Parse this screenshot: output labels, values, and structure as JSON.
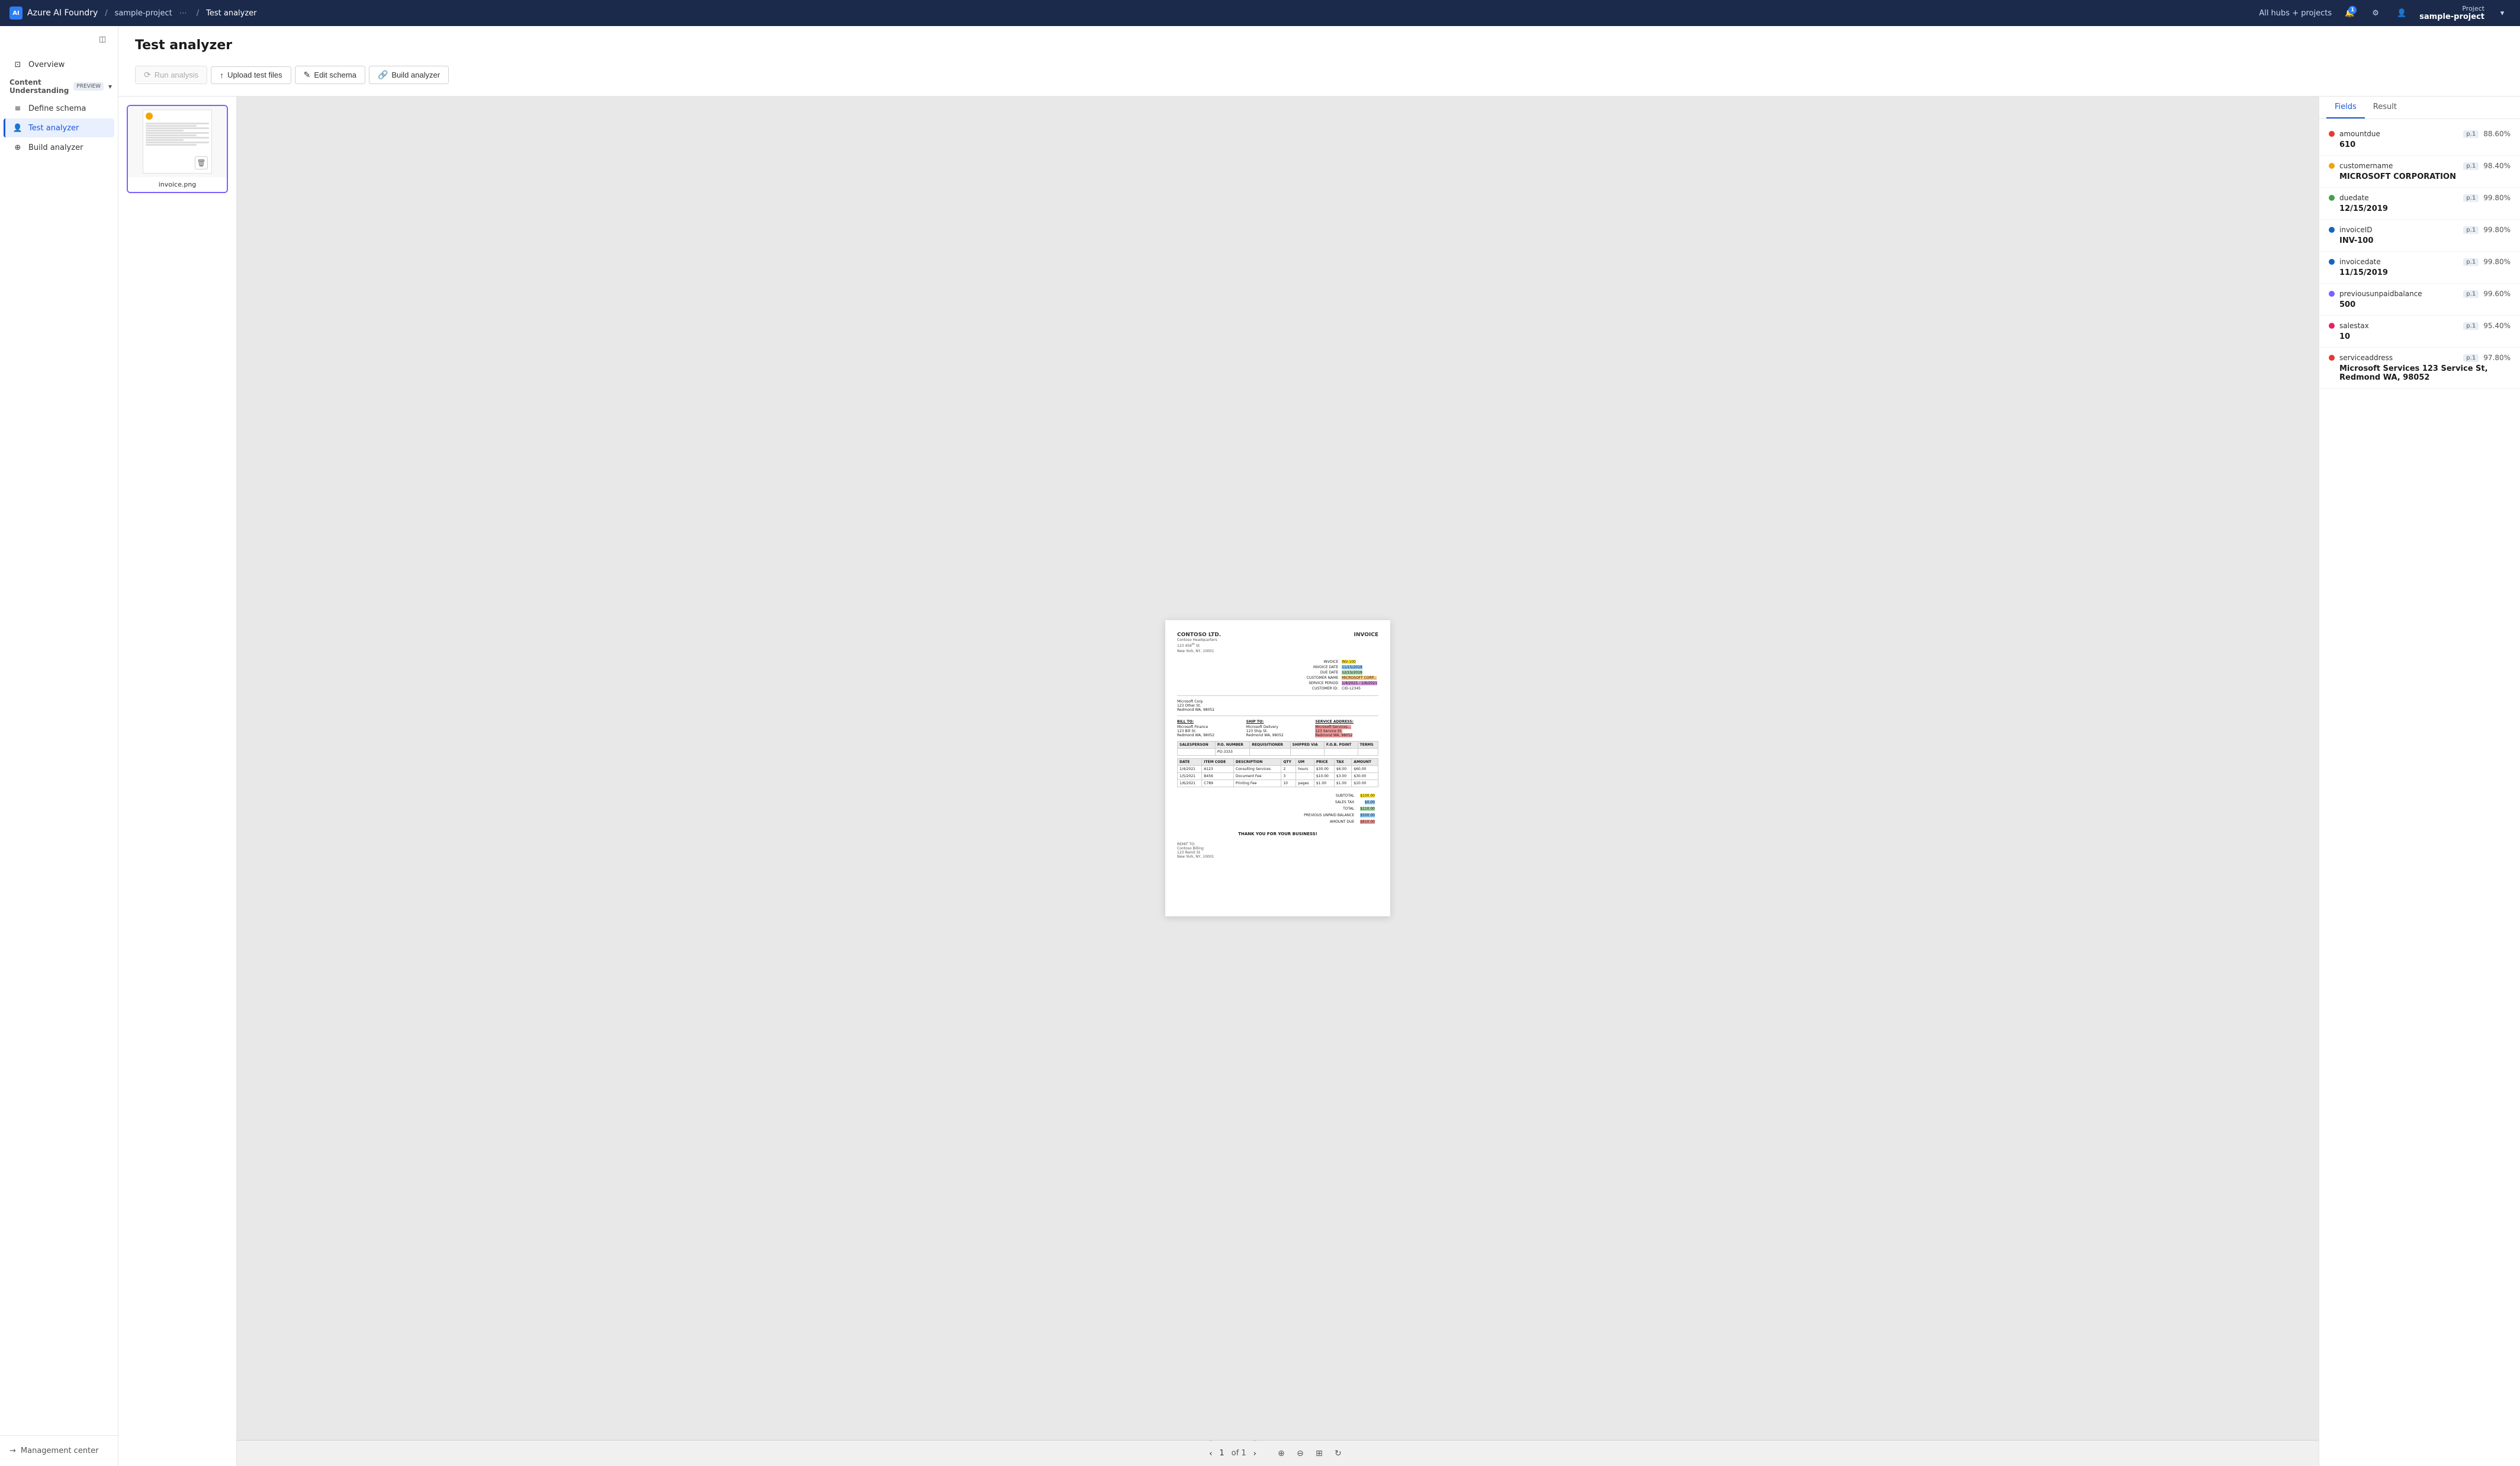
{
  "topNav": {
    "brand": "Azure AI Foundry",
    "project": "sample-project",
    "separator1": "/",
    "currentPage": "Test analyzer",
    "hubsLink": "All hubs + projects",
    "notificationCount": "1",
    "projectLabel": "Project",
    "projectName": "sample-project"
  },
  "sidebar": {
    "toggleIcon": "◫",
    "items": [
      {
        "id": "overview",
        "label": "Overview",
        "icon": "⊡"
      },
      {
        "id": "content-understanding",
        "label": "Content Understanding",
        "preview": "PREVIEW",
        "isSection": true
      },
      {
        "id": "define-schema",
        "label": "Define schema",
        "icon": "≡"
      },
      {
        "id": "test-analyzer",
        "label": "Test analyzer",
        "icon": "👤",
        "active": true
      },
      {
        "id": "build-analyzer",
        "label": "Build analyzer",
        "icon": "⊕"
      }
    ],
    "bottomItem": {
      "label": "Management center",
      "icon": "→"
    }
  },
  "page": {
    "title": "Test analyzer"
  },
  "toolbar": {
    "runAnalysis": "Run analysis",
    "uploadTestFiles": "Upload test files",
    "editSchema": "Edit schema",
    "buildAnalyzer": "Build analyzer"
  },
  "filePanel": {
    "file": {
      "name": "invoice.png",
      "hasCircle": true
    }
  },
  "docViewer": {
    "pageNumber": "1",
    "pageInfo": "of 1"
  },
  "fieldsPanel": {
    "tabs": [
      "Fields",
      "Result"
    ],
    "activeTab": "Fields",
    "fields": [
      {
        "id": "amountdue",
        "name": "amountdue",
        "dot": "#e53935",
        "page": "p.1",
        "confidence": "88.60%",
        "value": "610"
      },
      {
        "id": "customername",
        "name": "customername",
        "dot": "#f0a500",
        "page": "p.1",
        "confidence": "98.40%",
        "value": "MICROSOFT CORPORATION"
      },
      {
        "id": "duedate",
        "name": "duedate",
        "dot": "#43a047",
        "page": "p.1",
        "confidence": "99.80%",
        "value": "12/15/2019"
      },
      {
        "id": "invoiceID",
        "name": "invoiceID",
        "dot": "#1565c0",
        "page": "p.1",
        "confidence": "99.80%",
        "value": "INV-100"
      },
      {
        "id": "invoicedate",
        "name": "invoicedate",
        "dot": "#1565c0",
        "page": "p.1",
        "confidence": "99.80%",
        "value": "11/15/2019"
      },
      {
        "id": "previousunpaidbalance",
        "name": "previousunpaidbalance",
        "dot": "#7b61ff",
        "page": "p.1",
        "confidence": "99.60%",
        "value": "500"
      },
      {
        "id": "salestax",
        "name": "salestax",
        "dot": "#e91e63",
        "page": "p.1",
        "confidence": "95.40%",
        "value": "10"
      },
      {
        "id": "serviceaddress",
        "name": "serviceaddress",
        "dot": "#e53935",
        "page": "p.1",
        "confidence": "97.80%",
        "value": "Microsoft Services 123 Service St, Redmond WA, 98052"
      }
    ]
  }
}
